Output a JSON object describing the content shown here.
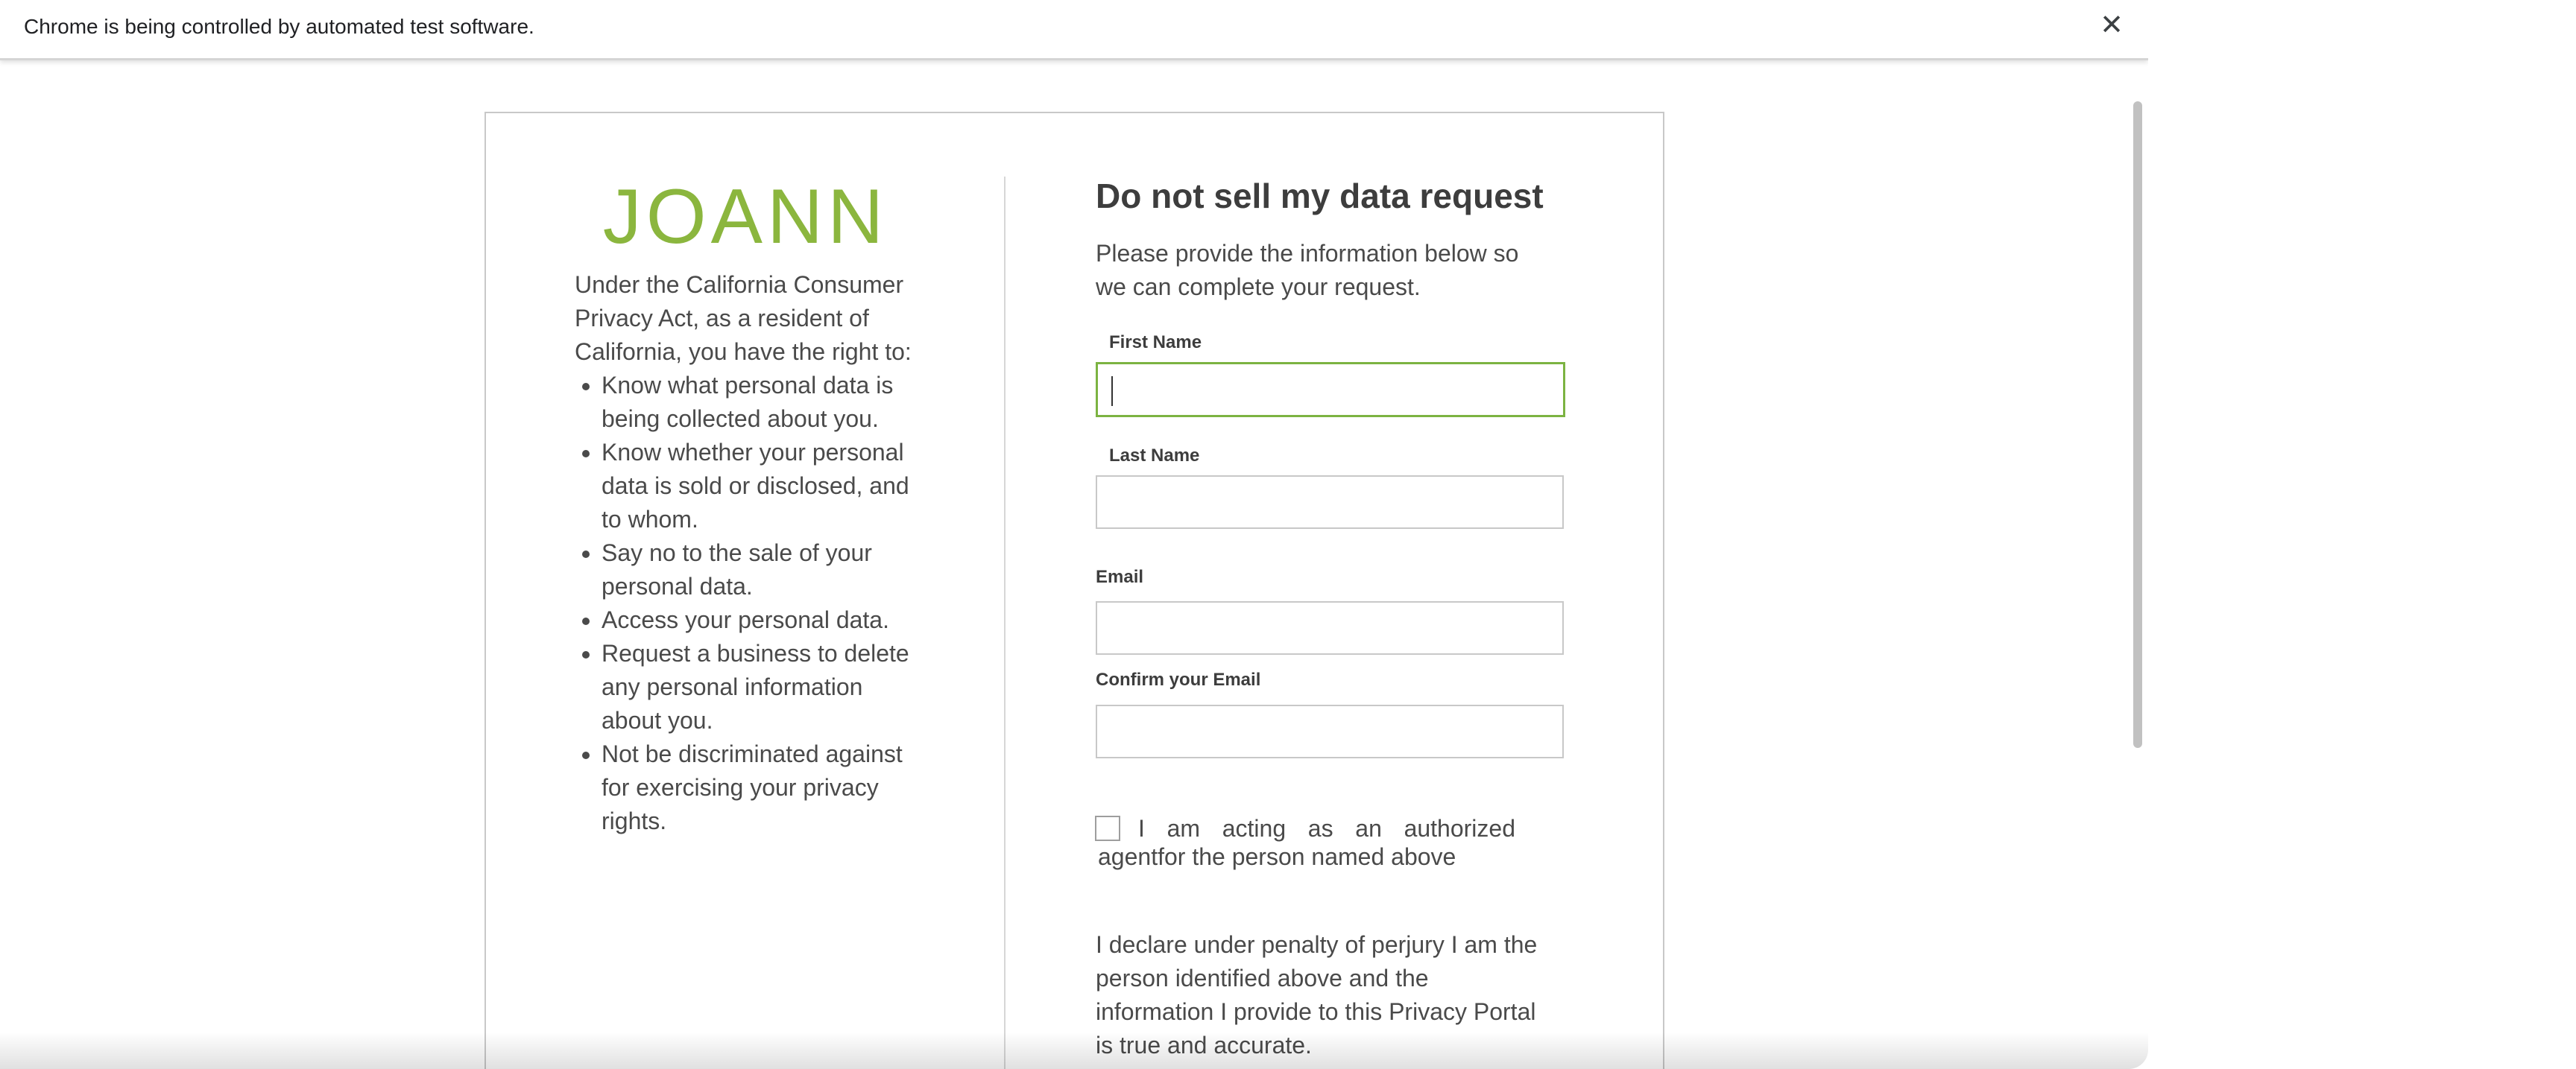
{
  "automation_bar": {
    "message": "Chrome is being controlled by automated test software.",
    "close_glyph": "✕"
  },
  "brand": {
    "logo_text": "JOANN",
    "logo_color": "#8bb63e"
  },
  "left_panel": {
    "intro": "Under the California Consumer Privacy Act, as a resident of California, you have the right to:",
    "rights": [
      "Know what personal data is being collected about you.",
      "Know whether your personal data is sold or disclosed, and to whom.",
      "Say no to the sale of your personal data.",
      "Access your personal data.",
      "Request a business to delete any personal information about you.",
      "Not be discriminated against for exercising your privacy rights."
    ]
  },
  "form": {
    "title": "Do not sell my data request",
    "intro": "Please provide the information below so we can complete your request.",
    "first_name_label": "First Name",
    "first_name_value": "",
    "last_name_label": "Last Name",
    "last_name_value": "",
    "email_label": "Email",
    "email_value": "",
    "confirm_email_label": "Confirm your Email",
    "confirm_email_value": "",
    "agent_checkbox_label": "I am acting as an authorized agentfor the person named above",
    "agent_checked": false,
    "declaration": "I declare under penalty of perjury I am the person identified above and the information I provide to this Privacy Portal is true and accurate."
  },
  "colors": {
    "focus_border": "#7cb342",
    "text": "#4a4a4a"
  }
}
